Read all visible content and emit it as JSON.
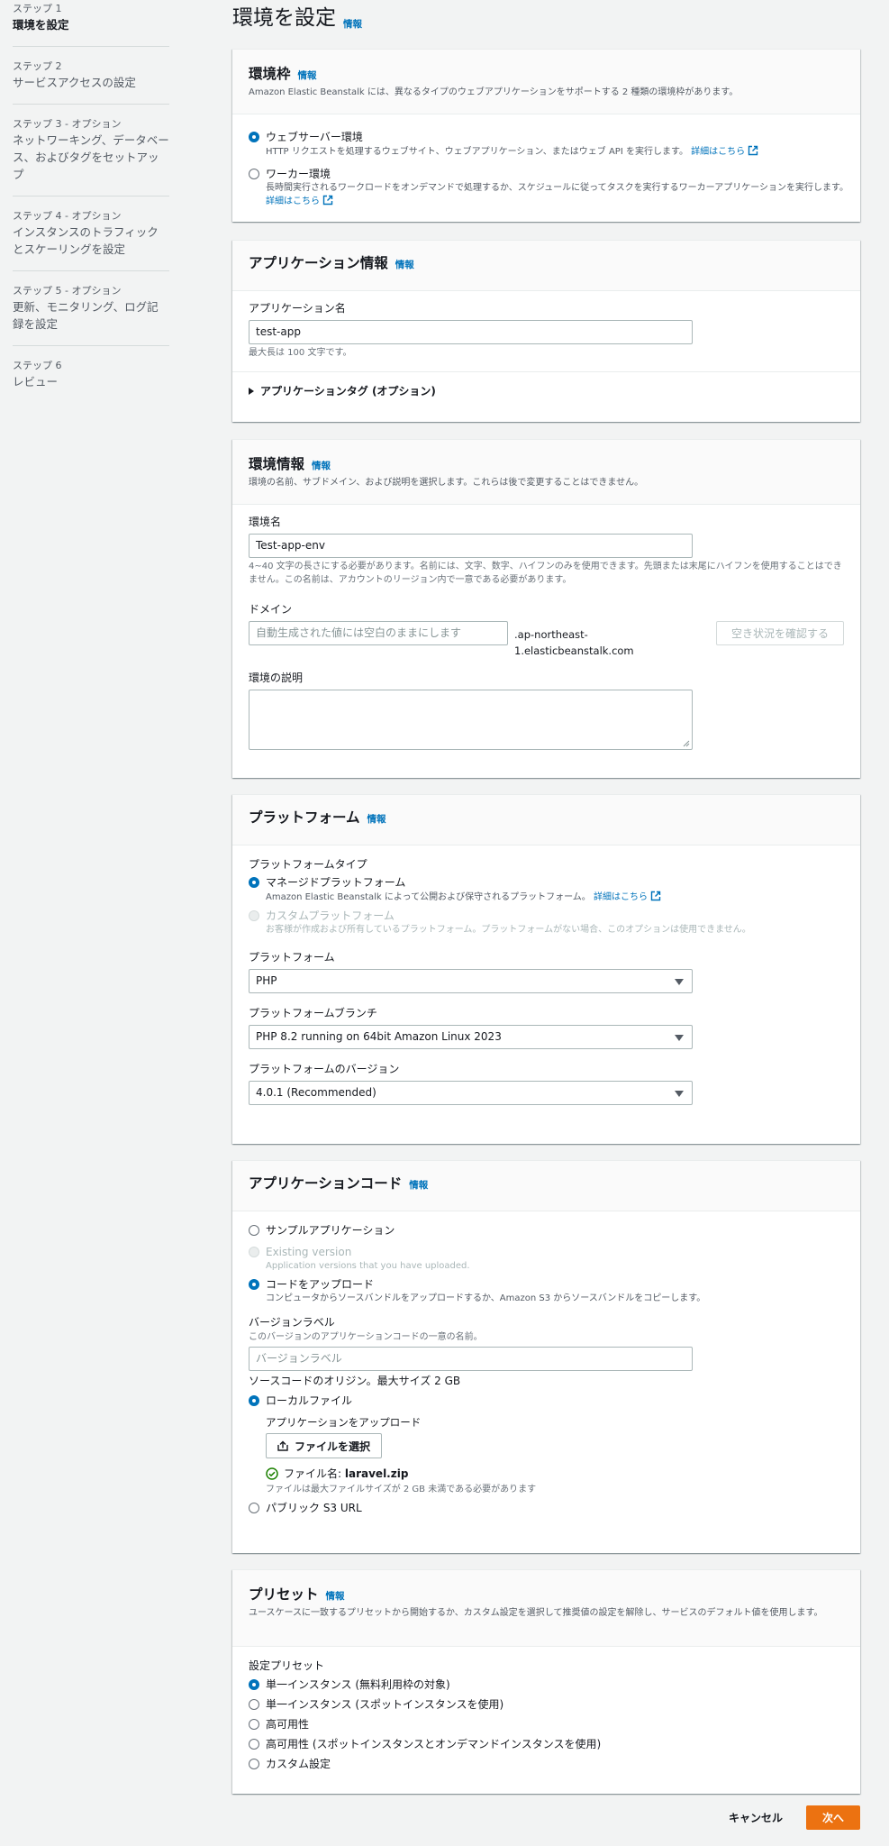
{
  "sidebar": {
    "steps": [
      {
        "num": "ステップ 1",
        "title": "環境を設定"
      },
      {
        "num": "ステップ 2",
        "title": "サービスアクセスの設定"
      },
      {
        "num": "ステップ 3 - オプション",
        "title": "ネットワーキング、データベース、およびタグをセットアップ"
      },
      {
        "num": "ステップ 4 - オプション",
        "title": "インスタンスのトラフィックとスケーリングを設定"
      },
      {
        "num": "ステップ 5 - オプション",
        "title": "更新、モニタリング、ログ記録を設定"
      },
      {
        "num": "ステップ 6",
        "title": "レビュー"
      }
    ]
  },
  "page": {
    "title": "環境を設定",
    "info": "情報"
  },
  "env_tier": {
    "title": "環境枠",
    "info": "情報",
    "desc": "Amazon Elastic Beanstalk には、異なるタイプのウェブアプリケーションをサポートする 2 種類の環境枠があります。",
    "web_label": "ウェブサーバー環境",
    "web_desc": "HTTP リクエストを処理するウェブサイト、ウェブアプリケーション、またはウェブ API を実行します。",
    "web_link": "詳細はこちら",
    "worker_label": "ワーカー環境",
    "worker_desc": "長時間実行されるワークロードをオンデマンドで処理するか、スケジュールに従ってタスクを実行するワーカーアプリケーションを実行します。",
    "worker_link": "詳細はこちら"
  },
  "app_info": {
    "title": "アプリケーション情報",
    "info": "情報",
    "name_label": "アプリケーション名",
    "name_value": "test-app",
    "name_hint": "最大長は 100 文字です。",
    "tags_label": "アプリケーションタグ (オプション)"
  },
  "env_info": {
    "title": "環境情報",
    "info": "情報",
    "desc": "環境の名前、サブドメイン、および説明を選択します。これらは後で変更することはできません。",
    "name_label": "環境名",
    "name_value": "Test-app-env",
    "name_hint": "4~40 文字の長さにする必要があります。名前には、文字、数字、ハイフンのみを使用できます。先頭または末尾にハイフンを使用することはできません。この名前は、アカウントのリージョン内で一意である必要があります。",
    "domain_label": "ドメイン",
    "domain_placeholder": "自動生成された値には空白のままにします",
    "domain_suffix_1": ".ap-northeast-",
    "domain_suffix_2": "1.elasticbeanstalk.com",
    "check_button": "空き状況を確認する",
    "desc_label": "環境の説明"
  },
  "platform": {
    "title": "プラットフォーム",
    "info": "情報",
    "type_label": "プラットフォームタイプ",
    "managed_label": "マネージドプラットフォーム",
    "managed_desc": "Amazon Elastic Beanstalk によって公開および保守されるプラットフォーム。",
    "managed_link": "詳細はこちら",
    "custom_label": "カスタムプラットフォーム",
    "custom_desc": "お客様が作成および所有しているプラットフォーム。プラットフォームがない場合、このオプションは使用できません。",
    "platform_label": "プラットフォーム",
    "platform_value": "PHP",
    "branch_label": "プラットフォームブランチ",
    "branch_value": "PHP 8.2 running on 64bit Amazon Linux 2023",
    "version_label": "プラットフォームのバージョン",
    "version_value": "4.0.1 (Recommended)"
  },
  "app_code": {
    "title": "アプリケーションコード",
    "info": "情報",
    "sample_label": "サンプルアプリケーション",
    "existing_label": "Existing version",
    "existing_desc": "Application versions that you have uploaded.",
    "upload_label": "コードをアップロード",
    "upload_desc": "コンピュータからソースバンドルをアップロードするか、Amazon S3 からソースバンドルをコピーします。",
    "version_label": "バージョンラベル",
    "version_hint": "このバージョンのアプリケーションコードの一意の名前。",
    "version_placeholder": "バージョンラベル",
    "origin_label": "ソースコードのオリジン。最大サイズ 2 GB",
    "local_label": "ローカルファイル",
    "upload_app_label": "アプリケーションをアップロード",
    "choose_file": "ファイルを選択",
    "file_prefix": "ファイル名:",
    "file_name": "laravel.zip",
    "file_hint": "ファイルは最大ファイルサイズが 2 GB 未満である必要があります",
    "s3_label": "パブリック S3 URL"
  },
  "presets": {
    "title": "プリセット",
    "info": "情報",
    "desc": "ユースケースに一致するプリセットから開始するか、カスタム設定を選択して推奨値の設定を解除し、サービスのデフォルト値を使用します。",
    "label": "設定プリセット",
    "options": [
      "単一インスタンス (無料利用枠の対象)",
      "単一インスタンス (スポットインスタンスを使用)",
      "高可用性",
      "高可用性 (スポットインスタンスとオンデマンドインスタンスを使用)",
      "カスタム設定"
    ]
  },
  "footer": {
    "cancel": "キャンセル",
    "next": "次へ"
  },
  "colors": {
    "accent": "#0073bb",
    "primary": "#ec7211",
    "background": "#f2f3f3"
  }
}
